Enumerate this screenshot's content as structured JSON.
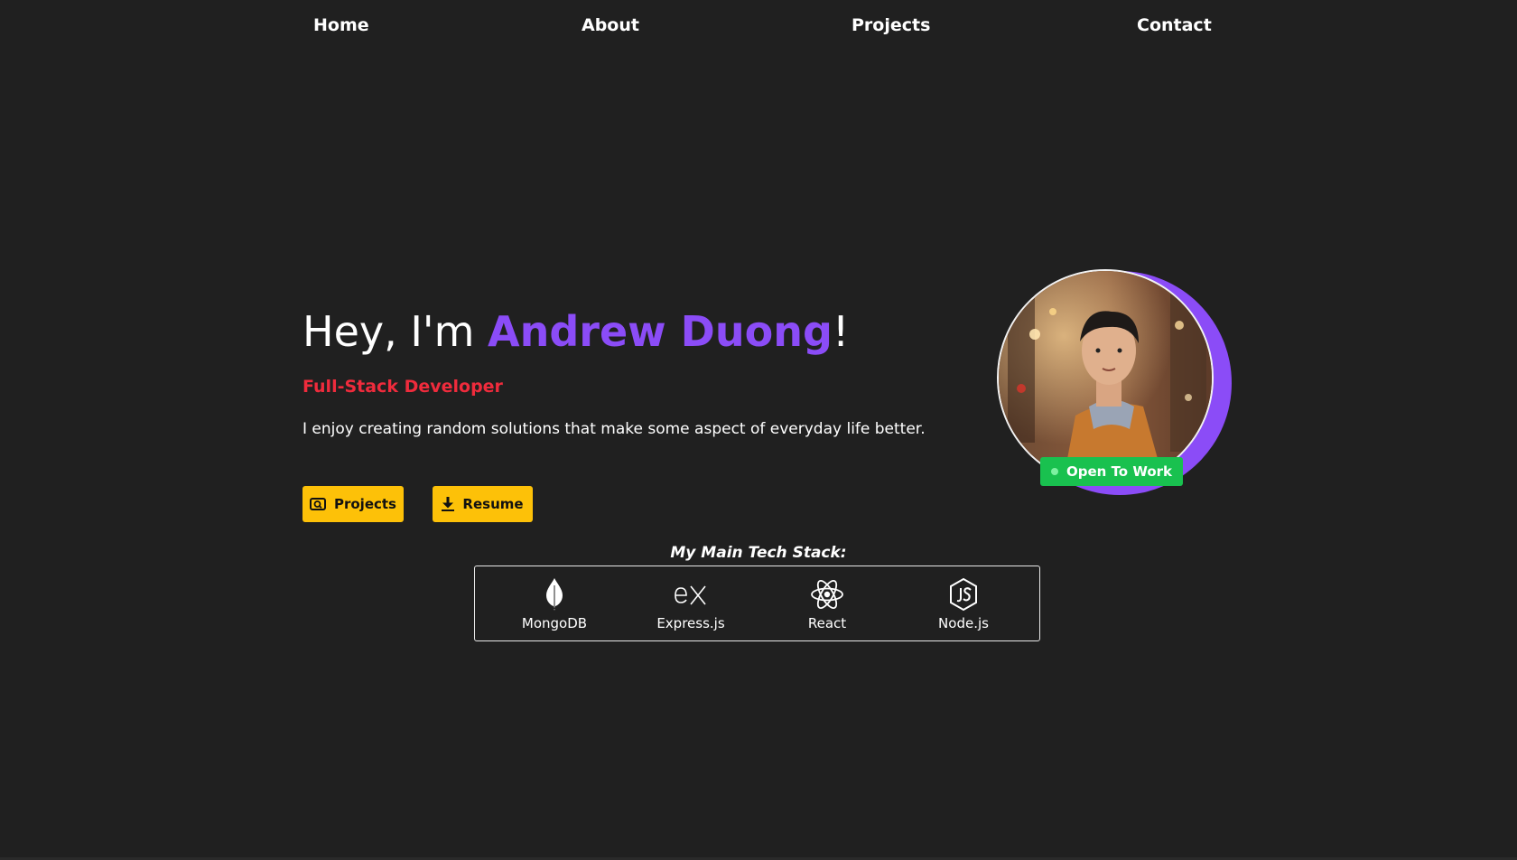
{
  "nav": {
    "items": [
      {
        "label": "Home"
      },
      {
        "label": "About"
      },
      {
        "label": "Projects"
      },
      {
        "label": "Contact"
      }
    ]
  },
  "hero": {
    "greeting": "Hey, I'm ",
    "name": "Andrew Duong",
    "exclaim": "!",
    "role": "Full-Stack Developer",
    "tagline": "I enjoy creating random solutions that make some aspect of everyday life better.",
    "projects_button": "Projects",
    "resume_button": "Resume"
  },
  "profile": {
    "status_badge": "Open To Work"
  },
  "stack": {
    "title": "My Main Tech Stack:",
    "items": [
      {
        "label": "MongoDB",
        "icon": "mongodb-icon"
      },
      {
        "label": "Express.js",
        "icon": "expressjs-icon"
      },
      {
        "label": "React",
        "icon": "react-icon"
      },
      {
        "label": "Node.js",
        "icon": "nodejs-icon"
      }
    ]
  },
  "colors": {
    "background": "#202020",
    "accent_purple": "#8b4cf7",
    "role_red": "#ef2b3c",
    "button_yellow": "#fdc108",
    "badge_green": "#19c14f"
  }
}
